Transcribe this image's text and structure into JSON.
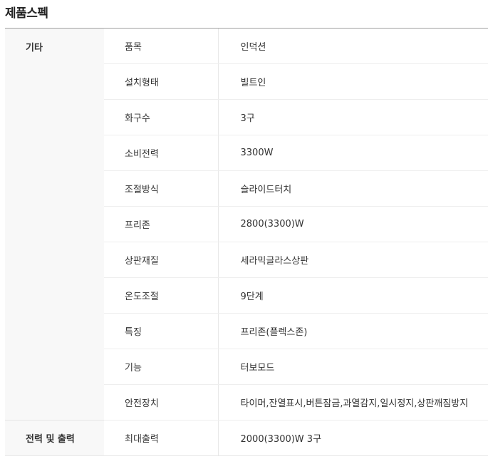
{
  "page": {
    "title": "제품스펙"
  },
  "spec": {
    "groups": [
      {
        "name": "기타",
        "rows": [
          {
            "label": "품목",
            "value": "인덕션"
          },
          {
            "label": "설치형태",
            "value": "빌트인"
          },
          {
            "label": "화구수",
            "value": "3구"
          },
          {
            "label": "소비전력",
            "value": "3300W"
          },
          {
            "label": "조절방식",
            "value": "슬라이드터치"
          },
          {
            "label": "프리존",
            "value": "2800(3300)W"
          },
          {
            "label": "상판재질",
            "value": "세라믹글라스상판"
          },
          {
            "label": "온도조절",
            "value": "9단계"
          },
          {
            "label": "특징",
            "value": "프리존(플렉스존)"
          },
          {
            "label": "기능",
            "value": "터보모드"
          },
          {
            "label": "안전장치",
            "value": "타이머,잔열표시,버튼잠금,과열감지,일시정지,상판깨짐방지"
          }
        ]
      },
      {
        "name": "전력 및 출력",
        "rows": [
          {
            "label": "최대출력",
            "value": "2000(3300)W 3구"
          }
        ]
      }
    ]
  }
}
